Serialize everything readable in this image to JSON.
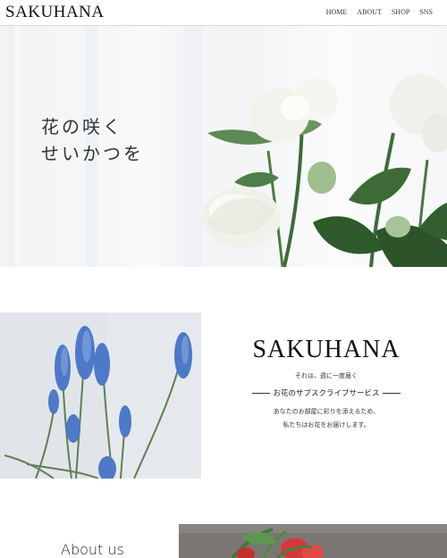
{
  "header": {
    "logo": "SAKUHANA",
    "nav": [
      "HOME",
      "ABOUT",
      "SHOP",
      "SNS"
    ]
  },
  "hero": {
    "line1": "花の咲く",
    "line2": "せいかつを"
  },
  "feature": {
    "brand": "SAKUHANA",
    "tagline": "それは、週に一度届く",
    "subtitle": "お花のサブスクライブサービス",
    "desc1": "あなたのお部屋に彩りを添えるため、",
    "desc2": "私たちはお花をお届けします。"
  },
  "about": {
    "title": "About us"
  }
}
